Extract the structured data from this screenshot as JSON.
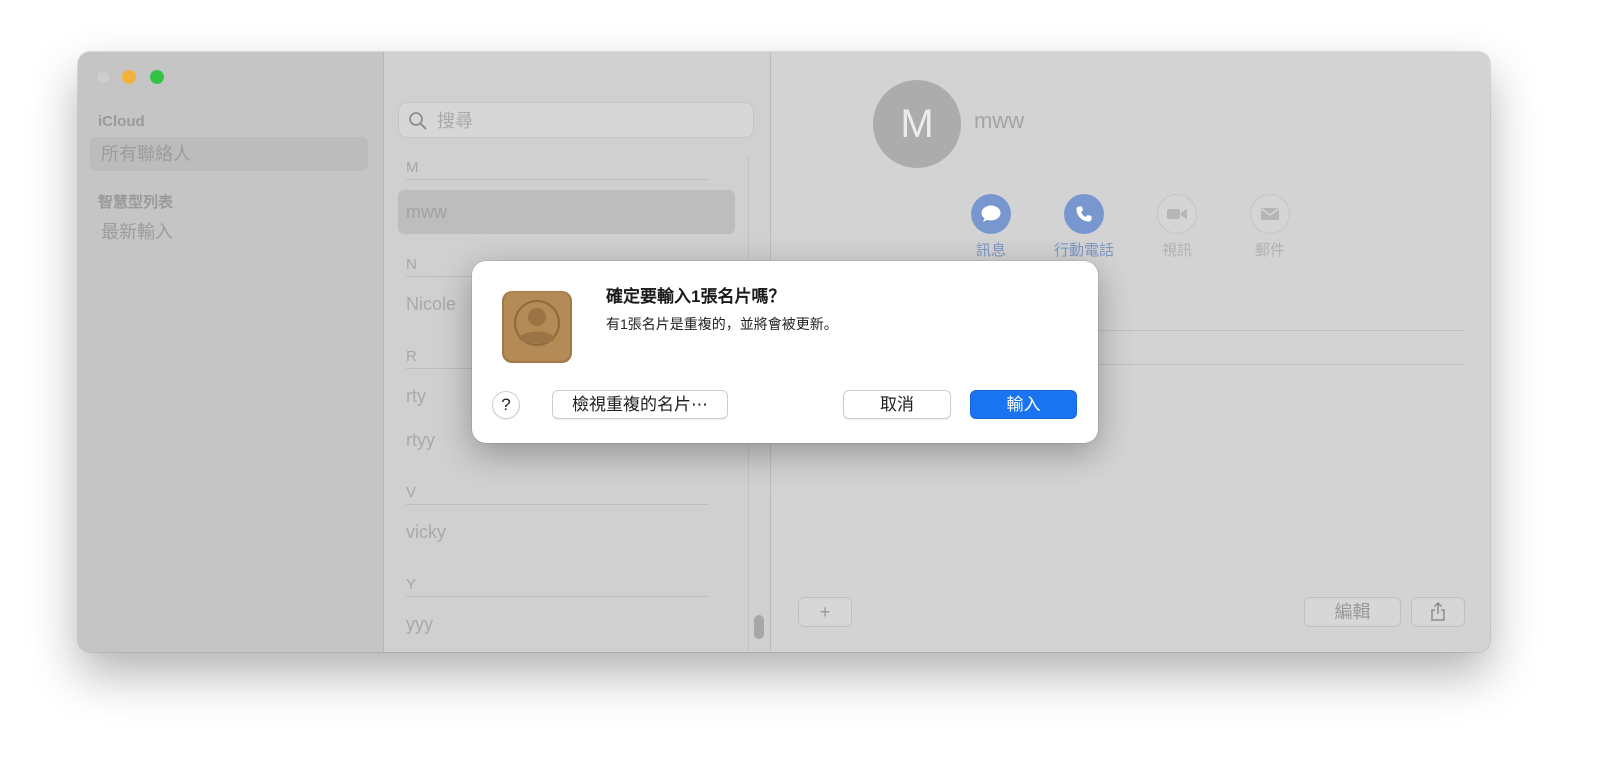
{
  "sidebar": {
    "section_icloud": "iCloud",
    "item_all_contacts": "所有聯絡人",
    "section_smart_lists": "智慧型列表",
    "item_last_import": "最新輸入"
  },
  "list": {
    "search_placeholder": "搜尋",
    "groups": [
      {
        "letter": "M",
        "contacts": [
          "mww"
        ]
      },
      {
        "letter": "N",
        "contacts": [
          "Nicole"
        ]
      },
      {
        "letter": "R",
        "contacts": [
          "rty",
          "rtyy"
        ]
      },
      {
        "letter": "V",
        "contacts": [
          "vicky"
        ]
      },
      {
        "letter": "Y",
        "contacts": [
          "yyy"
        ]
      }
    ]
  },
  "detail": {
    "avatar_initial": "M",
    "name": "mww",
    "actions": {
      "message": "訊息",
      "mobile": "行動電話",
      "video": "視訊",
      "mail": "郵件"
    },
    "field_partial": "3",
    "add_label": "+",
    "edit_label": "編輯"
  },
  "dialog": {
    "title": "確定要輸入1張名片嗎？",
    "message": "有1張名片是重複的，並將會被更新。",
    "help_label": "?",
    "review_label": "檢視重複的名片⋯",
    "cancel_label": "取消",
    "import_label": "輸入"
  },
  "colors": {
    "primary_button": "#1a73f0",
    "action_active": "#7897cf",
    "traffic_minimize": "#f2b33a",
    "traffic_maximize": "#35c346"
  },
  "icons": [
    "search-icon",
    "message-icon",
    "phone-icon",
    "video-icon",
    "mail-icon",
    "share-icon",
    "contacts-app-icon"
  ]
}
